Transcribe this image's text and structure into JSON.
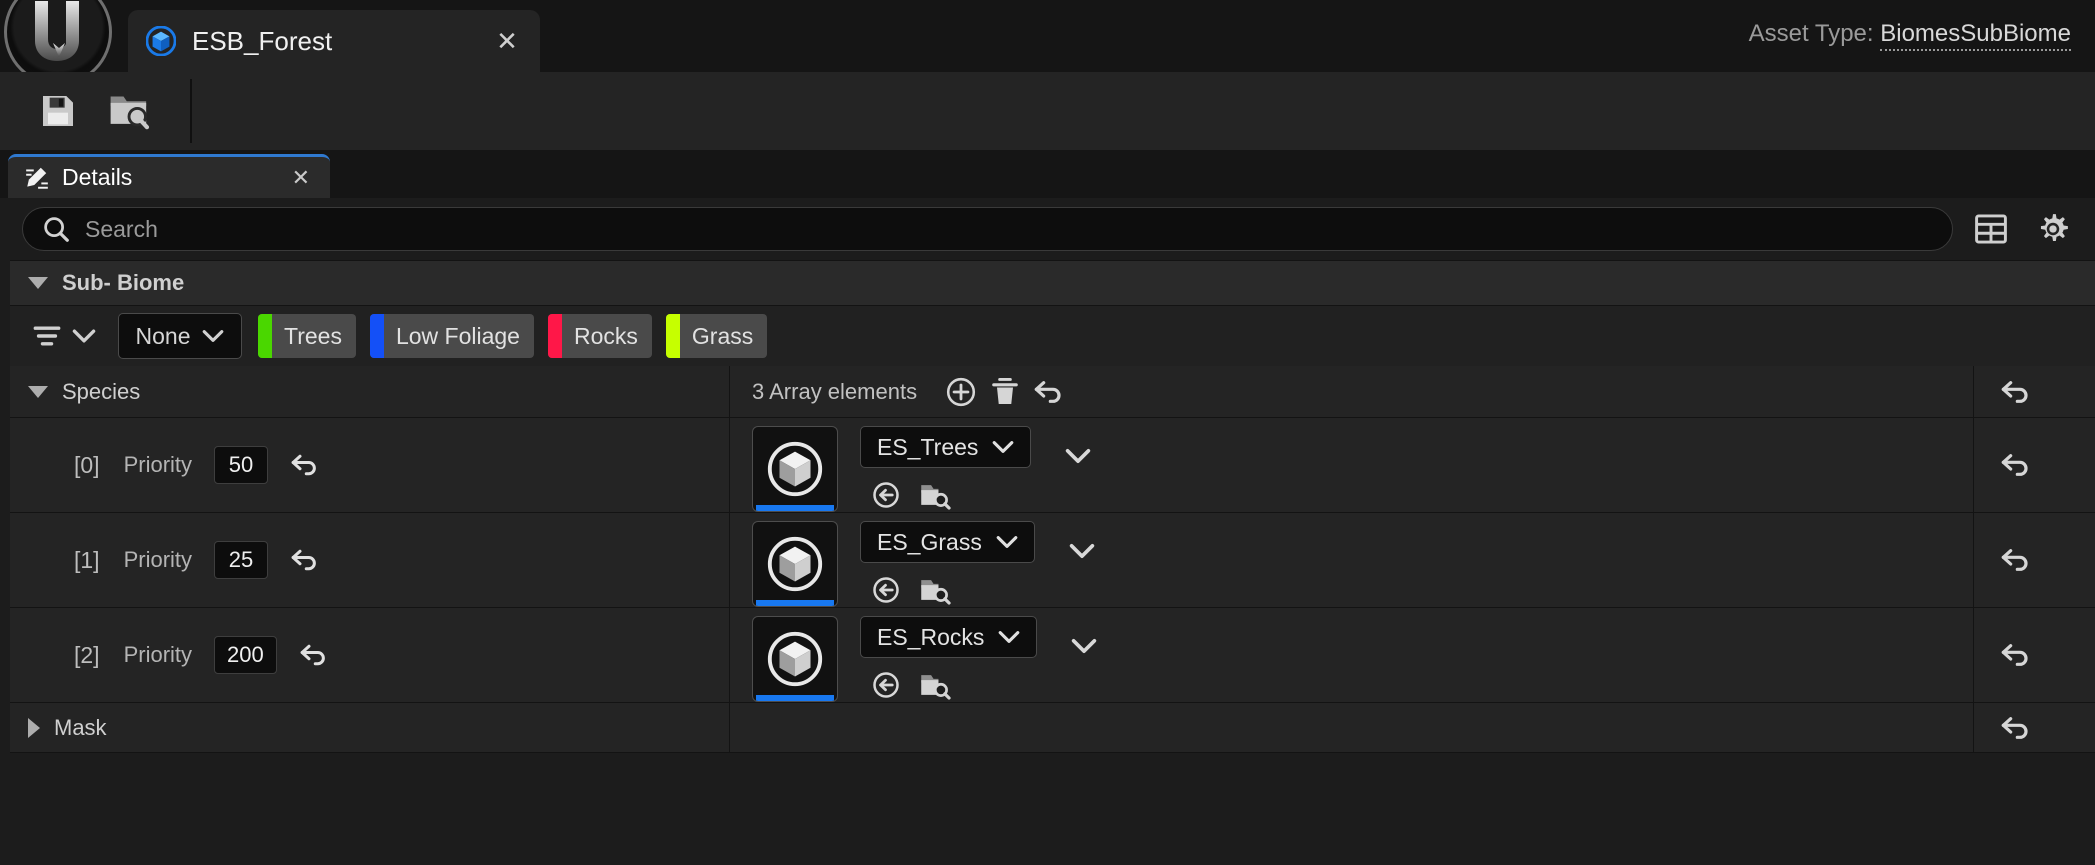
{
  "titlebar": {
    "logo_icon": "unreal-engine-logo",
    "document_tab": {
      "icon": "blue-cube-asset-icon",
      "label": "ESB_Forest",
      "close_label": "✕"
    },
    "asset_type_prefix": "Asset Type:",
    "asset_type_value": "BiomesSubBiome"
  },
  "toolbar": {
    "buttons": [
      {
        "name": "save-button",
        "icon": "save-floppy-icon"
      },
      {
        "name": "browse-button",
        "icon": "folder-search-icon"
      }
    ]
  },
  "details_panel": {
    "tab": {
      "icon": "details-pencil-icon",
      "label": "Details",
      "close_label": "✕"
    },
    "search": {
      "icon": "search-icon",
      "placeholder": "Search",
      "value": ""
    },
    "search_tools": [
      {
        "name": "column-layout-toggle",
        "icon": "table-grid-icon"
      },
      {
        "name": "view-options-button",
        "icon": "gear-icon"
      }
    ],
    "sections": {
      "sub_biome": {
        "title": "Sub- Biome",
        "expanded": true
      },
      "mask": {
        "title": "Mask",
        "expanded": false
      }
    },
    "tag_row": {
      "filter_icon": "filter-lines-icon",
      "filter_chevron": "chevron-down-icon",
      "dropdown_value": "None",
      "dropdown_chevron": "chevron-down-icon",
      "tags": [
        {
          "label": "Trees",
          "color": "#4ad700"
        },
        {
          "label": "Low Foliage",
          "color": "#1450f7"
        },
        {
          "label": "Rocks",
          "color": "#ff1748"
        },
        {
          "label": "Grass",
          "color": "#c6ff00"
        }
      ]
    },
    "species": {
      "label": "Species",
      "expanded": true,
      "array_count_text": "3 Array elements",
      "array_actions": [
        {
          "name": "add-element-button",
          "icon": "plus-circle-icon"
        },
        {
          "name": "delete-all-elements-button",
          "icon": "trash-icon"
        },
        {
          "name": "reset-array-button",
          "icon": "reset-arrow-icon"
        }
      ],
      "elements": [
        {
          "index_label": "[0]",
          "priority_label": "Priority",
          "priority_value": "50",
          "asset_name": "ES_Trees",
          "thumbnail_icon": "cube-asset-thumbnail",
          "thumbnail_accent": "#1878f0"
        },
        {
          "index_label": "[1]",
          "priority_label": "Priority",
          "priority_value": "25",
          "asset_name": "ES_Grass",
          "thumbnail_icon": "cube-asset-thumbnail",
          "thumbnail_accent": "#1878f0"
        },
        {
          "index_label": "[2]",
          "priority_label": "Priority",
          "priority_value": "200",
          "asset_name": "ES_Rocks",
          "thumbnail_icon": "cube-asset-thumbnail",
          "thumbnail_accent": "#1878f0"
        }
      ]
    },
    "row_icons": {
      "reset_icon": "reset-arrow-icon",
      "browse_to_asset_icon": "browse-to-asset-icon",
      "pick_asset_icon": "folder-search-icon",
      "expand_icon": "chevron-down-icon",
      "picker_chevron": "chevron-down-icon"
    }
  },
  "colors": {
    "accent_blue": "#2f79d0",
    "thumbnail_accent": "#1878f0",
    "panel_bg": "#1c1c1c",
    "row_bg": "#242424"
  }
}
